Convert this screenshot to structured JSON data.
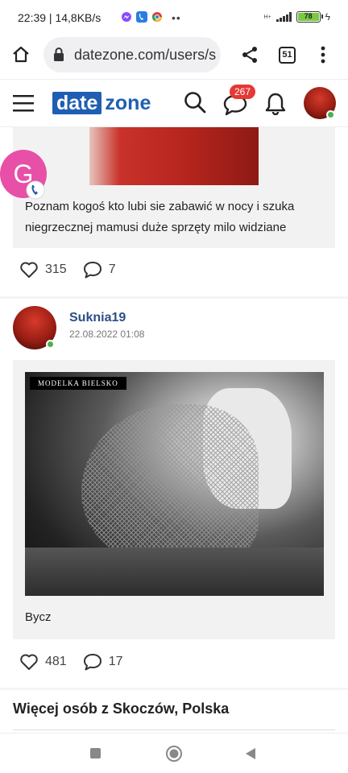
{
  "status_bar": {
    "time": "22:39",
    "speed": "14,8KB/s",
    "network": "H+",
    "battery": "78"
  },
  "browser": {
    "url": "datezone.com/users/s",
    "tab_count": "51"
  },
  "header": {
    "logo_date": "date",
    "logo_zone": "zone",
    "message_badge": "267"
  },
  "post1": {
    "author_initial": "G",
    "text": "Poznam kogoś kto lubi sie zabawić w nocy i szuka niegrzecznej mamusi duże sprzęty milo widziane",
    "likes": "315",
    "comments": "7"
  },
  "post2": {
    "username": "Suknia19",
    "date": "22.08.2022 01:08",
    "photo_watermark": "MODELKA BIELSKO",
    "text": "Bycz",
    "likes": "481",
    "comments": "17"
  },
  "more_section": {
    "title": "Więcej osób z Skoczów, Polska"
  },
  "colors": {
    "brand_blue": "#1f5fb2",
    "badge_red": "#e53935",
    "online_green": "#4caf50",
    "avatar_pink": "#e84fa7"
  }
}
